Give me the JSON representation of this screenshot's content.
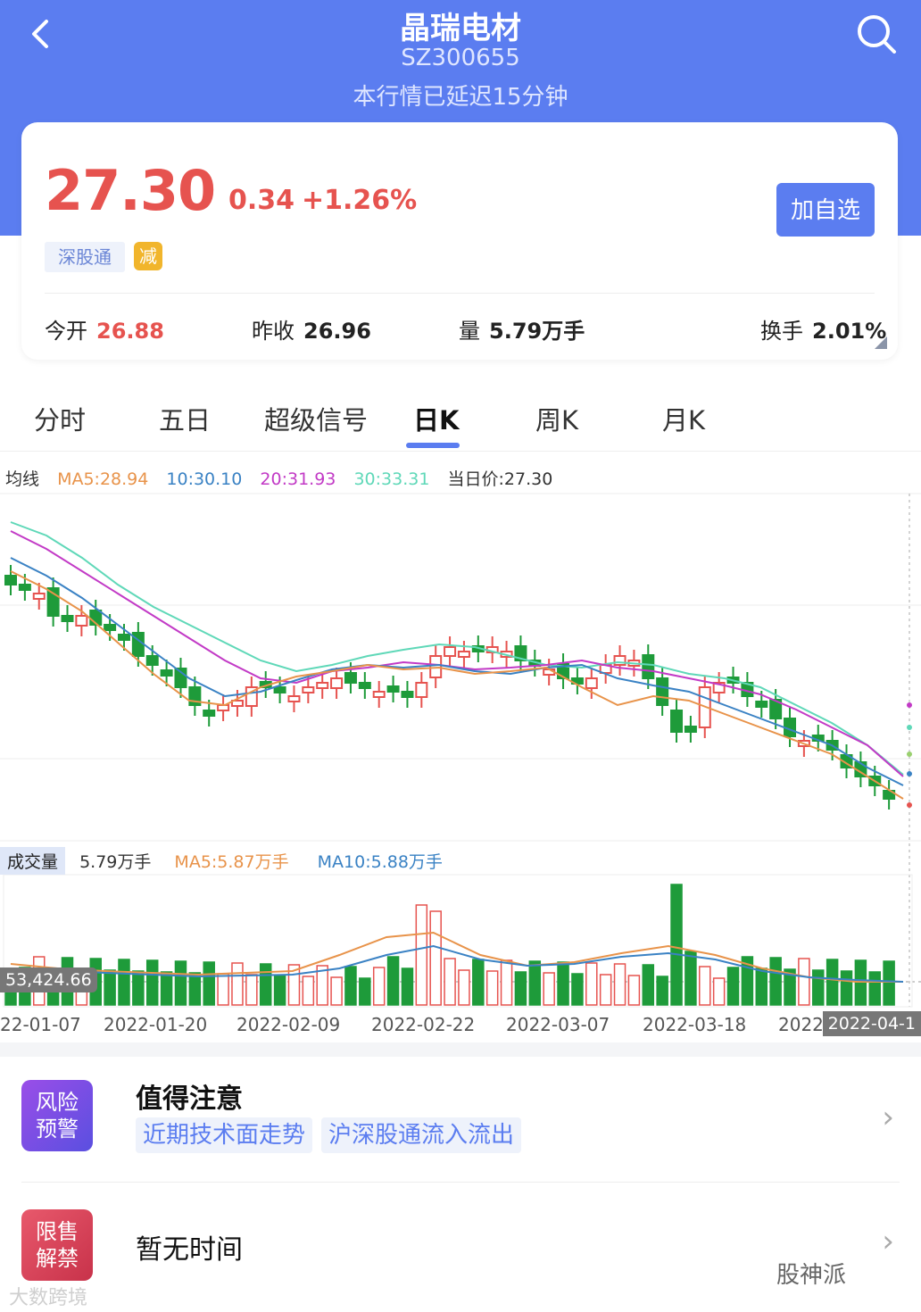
{
  "header": {
    "title": "晶瑞电材",
    "code": "SZ300655",
    "delay_note": "本行情已延迟15分钟"
  },
  "quote": {
    "price": "27.30",
    "change": "0.34",
    "change_pct": "+1.26%",
    "tag_connect": "深股通",
    "tag_reduce": "减",
    "add_button": "加自选",
    "open_label": "今开",
    "open_value": "26.88",
    "prev_close_label": "昨收",
    "prev_close_value": "26.96",
    "volume_label": "量",
    "volume_value": "5.79万手",
    "turnover_label": "换手",
    "turnover_value": "2.01%"
  },
  "tabs": [
    "分时",
    "五日",
    "超级信号",
    "日K",
    "周K",
    "月K"
  ],
  "active_tab": "日K",
  "ma_legend": {
    "label": "均线",
    "ma5": "MA5:28.94",
    "ma10": "10:30.10",
    "ma20": "20:31.93",
    "ma30": "30:33.31",
    "today_price": "当日价:27.30"
  },
  "volume_legend": {
    "label": "成交量",
    "value": "5.79万手",
    "ma5": "MA5:5.87万手",
    "ma10": "MA10:5.88万手"
  },
  "crosshair": {
    "price_label": "53,424.66",
    "date_label": "2022-04-1"
  },
  "x_axis_labels": [
    "22-01-07",
    "2022-01-20",
    "2022-02-09",
    "2022-02-22",
    "2022-03-07",
    "2022-03-18",
    "2022"
  ],
  "colors": {
    "up": "#e6534f",
    "down": "#1e9b3a",
    "ma5": "#e8934a",
    "ma10": "#3a82c4",
    "ma20": "#c23ac6",
    "ma30": "#5fd8b8",
    "accent": "#5b7df0"
  },
  "chart_data": {
    "type": "candlestick",
    "series_count": 60,
    "close_last": 27.3,
    "ma": {
      "MA5": 28.94,
      "MA10": 30.1,
      "MA20": 31.93,
      "MA30": 33.31
    },
    "volume": {
      "last": "5.79万手",
      "MA5": "5.87万手",
      "MA10": "5.88万手"
    },
    "x_ticks": [
      "22-01-07",
      "2022-01-20",
      "2022-02-09",
      "2022-02-22",
      "2022-03-07",
      "2022-03-18",
      "2022-04-1"
    ]
  },
  "alerts": {
    "risk_icon": [
      "风险",
      "预警"
    ],
    "risk_title": "值得注意",
    "risk_chips": [
      "近期技术面走势",
      "沪深股通流入流出"
    ],
    "lockup_icon": [
      "限售",
      "解禁"
    ],
    "lockup_title": "暂无时间"
  },
  "watermarks": {
    "left": "大数跨境",
    "right": "股神派"
  }
}
